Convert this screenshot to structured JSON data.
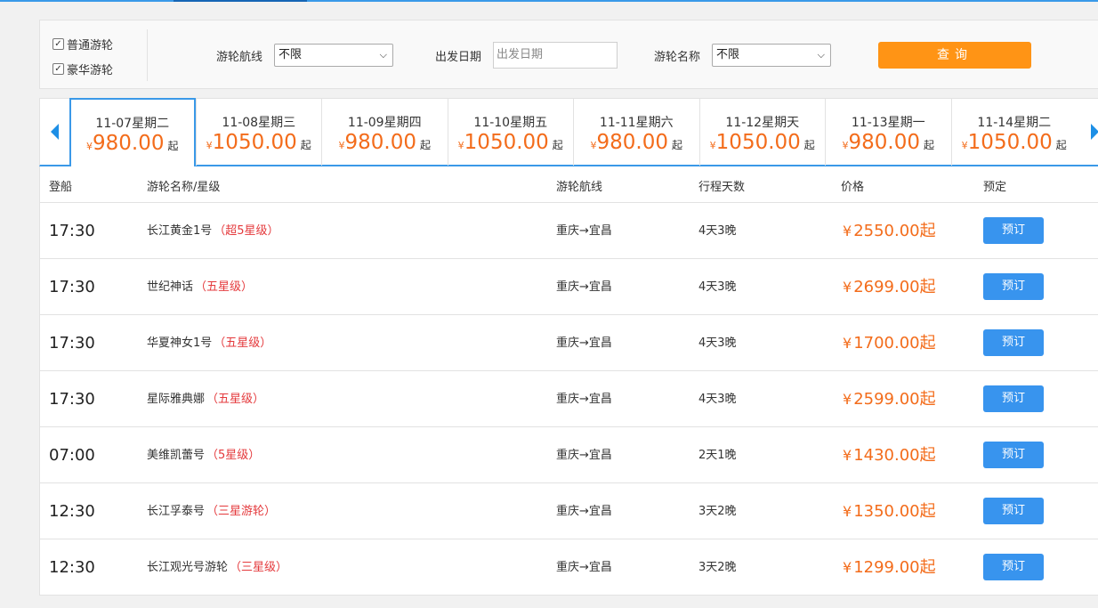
{
  "filter": {
    "checkboxes": [
      {
        "label": "普通游轮",
        "checked": true
      },
      {
        "label": "豪华游轮",
        "checked": true
      }
    ],
    "route_label": "游轮航线",
    "route_value": "不限",
    "date_label": "出发日期",
    "date_placeholder": "出发日期",
    "ship_label": "游轮名称",
    "ship_value": "不限",
    "query_label": "查询"
  },
  "dates": [
    {
      "label": "11-07星期二",
      "price": "980.00",
      "suffix": "起",
      "active": true
    },
    {
      "label": "11-08星期三",
      "price": "1050.00",
      "suffix": "起",
      "active": false
    },
    {
      "label": "11-09星期四",
      "price": "980.00",
      "suffix": "起",
      "active": false
    },
    {
      "label": "11-10星期五",
      "price": "1050.00",
      "suffix": "起",
      "active": false
    },
    {
      "label": "11-11星期六",
      "price": "980.00",
      "suffix": "起",
      "active": false
    },
    {
      "label": "11-12星期天",
      "price": "1050.00",
      "suffix": "起",
      "active": false
    },
    {
      "label": "11-13星期一",
      "price": "980.00",
      "suffix": "起",
      "active": false
    },
    {
      "label": "11-14星期二",
      "price": "1050.00",
      "suffix": "起",
      "active": false
    }
  ],
  "currency": "¥",
  "table": {
    "headers": [
      "登船",
      "游轮名称/星级",
      "游轮航线",
      "行程天数",
      "价格",
      "预定"
    ],
    "rows": [
      {
        "time": "17:30",
        "name": "长江黄金1号",
        "grade": "（超5星级）",
        "route": "重庆→宜昌",
        "days": "4天3晚",
        "price": "2550.00起",
        "book": "预订"
      },
      {
        "time": "17:30",
        "name": "世纪神话",
        "grade": "（五星级）",
        "route": "重庆→宜昌",
        "days": "4天3晚",
        "price": "2699.00起",
        "book": "预订"
      },
      {
        "time": "17:30",
        "name": "华夏神女1号",
        "grade": "（五星级）",
        "route": "重庆→宜昌",
        "days": "4天3晚",
        "price": "1700.00起",
        "book": "预订"
      },
      {
        "time": "17:30",
        "name": "星际雅典娜",
        "grade": "（五星级）",
        "route": "重庆→宜昌",
        "days": "4天3晚",
        "price": "2599.00起",
        "book": "预订"
      },
      {
        "time": "07:00",
        "name": "美维凯蕾号",
        "grade": "（5星级）",
        "route": "重庆→宜昌",
        "days": "2天1晚",
        "price": "1430.00起",
        "book": "预订"
      },
      {
        "time": "12:30",
        "name": "长江孚泰号",
        "grade": "（三星游轮）",
        "route": "重庆→宜昌",
        "days": "3天2晚",
        "price": "1350.00起",
        "book": "预订"
      },
      {
        "time": "12:30",
        "name": "长江观光号游轮",
        "grade": "（三星级）",
        "route": "重庆→宜昌",
        "days": "3天2晚",
        "price": "1299.00起",
        "book": "预订"
      }
    ]
  },
  "colors": {
    "accent": "#3a99e8",
    "price": "#f36c1b",
    "query": "#ff9415",
    "book": "#3894ee",
    "grade": "#e4393c"
  }
}
